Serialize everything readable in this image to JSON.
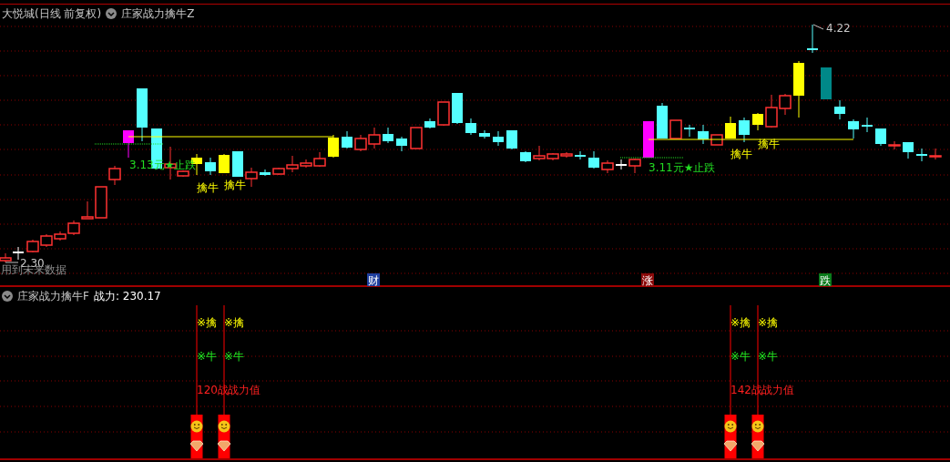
{
  "main_panel": {
    "title": "大悦城(日线 前复权)",
    "indicator": "庄家战力擒牛Z",
    "chart_labels": [
      {
        "kind": "stop",
        "text": "3.13元★止跌"
      },
      {
        "kind": "signal",
        "text": "擒牛"
      },
      {
        "kind": "signal",
        "text": "擒牛"
      },
      {
        "kind": "stop",
        "text": "3.11元★止跌"
      },
      {
        "kind": "signal",
        "text": "擒牛"
      },
      {
        "kind": "signal",
        "text": "擒牛"
      }
    ],
    "high_label": "4.22",
    "low_label": "2.30",
    "note": "用到未来数据",
    "event_markers": [
      {
        "text": "财",
        "color": "#1f3f9f"
      },
      {
        "text": "涨",
        "color": "#8b0a0a"
      },
      {
        "text": "跌",
        "color": "#0a7a1a"
      }
    ]
  },
  "sub_panel": {
    "indicator": "庄家战力擒牛F",
    "reading": "战力: 230.17",
    "signals": [
      {
        "catch": "※擒",
        "bull": "※牛",
        "power": "120战"
      },
      {
        "catch": "※擒",
        "bull": "※牛",
        "power": "战力值"
      },
      {
        "catch": "※擒",
        "bull": "※牛",
        "power": "142战"
      },
      {
        "catch": "※擒",
        "bull": "※牛",
        "power": "战力值"
      }
    ]
  }
}
